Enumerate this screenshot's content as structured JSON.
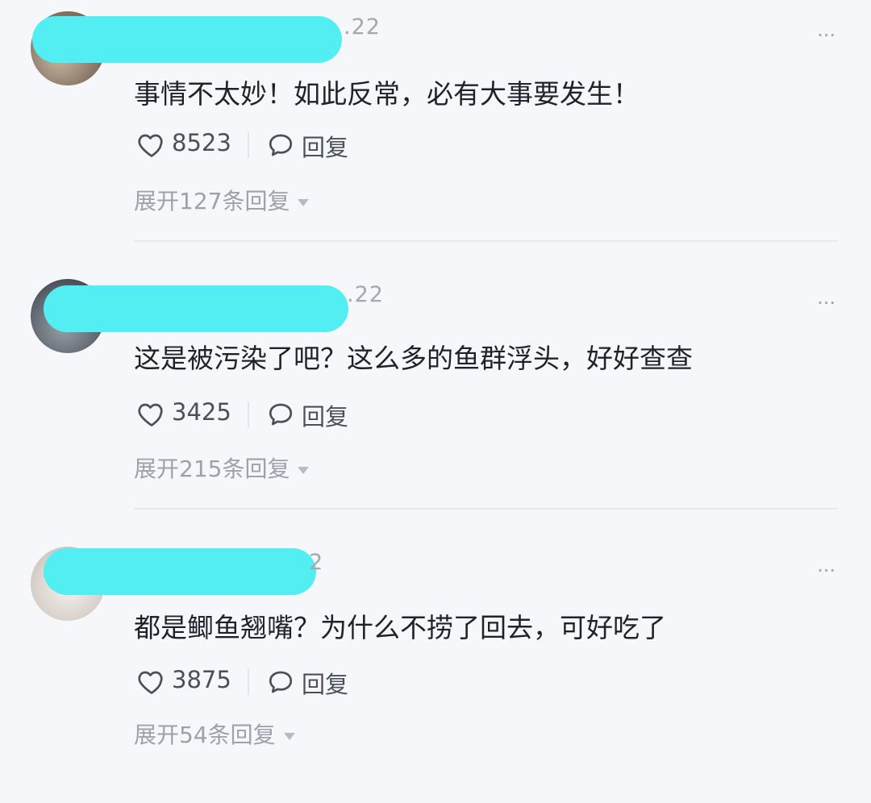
{
  "comments": [
    {
      "date_suffix": ".22",
      "text": "事情不太妙！如此反常，必有大事要发生！",
      "likes": "8523",
      "reply_label": "回复",
      "expand_label": "展开127条回复"
    },
    {
      "date_suffix": ".22",
      "text": "这是被污染了吧？这么多的鱼群浮头，好好查查",
      "likes": "3425",
      "reply_label": "回复",
      "expand_label": "展开215条回复"
    },
    {
      "date_suffix": "2",
      "text": "都是鲫鱼翘嘴？为什么不捞了回去，可好吃了",
      "likes": "3875",
      "reply_label": "回复",
      "expand_label": "展开54条回复"
    }
  ],
  "icons": {
    "like": "heart-icon",
    "reply": "comment-bubble-icon",
    "more": "more-dots-icon",
    "expand": "caret-down-icon"
  },
  "colors": {
    "redaction": "#53eef1",
    "background": "#f6f7fb",
    "text": "#1f2329",
    "muted": "#9da1a8"
  },
  "more_label": "···"
}
